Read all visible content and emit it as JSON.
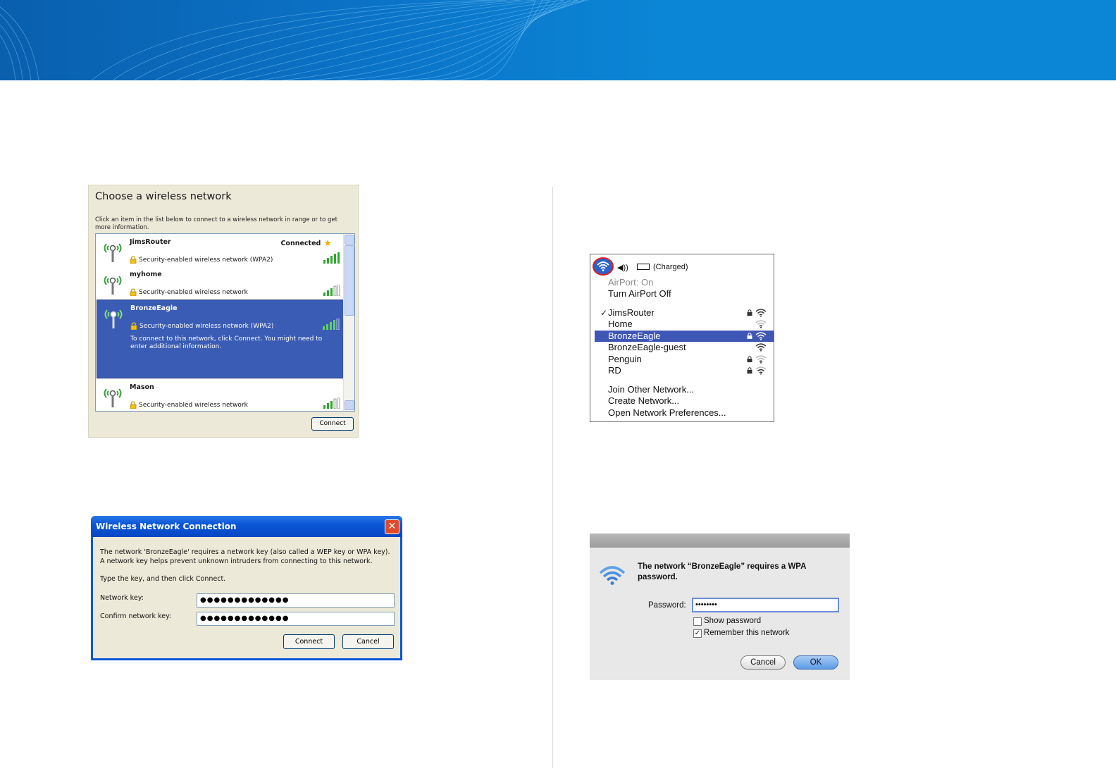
{
  "xp_choose": {
    "title": "Choose a wireless network",
    "instructions": "Click an item in the list below to connect to a wireless network in range or to get more information.",
    "networks": [
      {
        "name": "JimsRouter",
        "security": "Security-enabled wireless network (WPA2)",
        "status": "Connected",
        "signal_bars": 5
      },
      {
        "name": "myhome",
        "security": "Security-enabled wireless network",
        "status": "",
        "signal_bars": 3
      },
      {
        "name": "BronzeEagle",
        "security": "Security-enabled wireless network (WPA2)",
        "status": "",
        "signal_bars": 4,
        "hint": "To connect to this network, click Connect. You might need to enter additional information."
      },
      {
        "name": "Mason",
        "security": "Security-enabled wireless network",
        "status": "",
        "signal_bars": 3
      }
    ],
    "connect_label": "Connect"
  },
  "xp_dialog": {
    "title": "Wireless Network Connection",
    "message": "The network 'BronzeEagle' requires a network key (also called a WEP key or WPA key). A network key helps prevent unknown intruders from connecting to this network.",
    "message2": "Type the key, and then click Connect.",
    "network_key_label": "Network key:",
    "network_key_value": "●●●●●●●●●●●●●",
    "confirm_key_label": "Confirm network key:",
    "confirm_key_value": "●●●●●●●●●●●●●",
    "connect_label": "Connect",
    "cancel_label": "Cancel"
  },
  "mac_menu": {
    "charged": "(Charged)",
    "airport_status": "AirPort: On",
    "turn_off": "Turn AirPort Off",
    "networks": [
      {
        "name": "JimsRouter",
        "checked": true,
        "locked": true,
        "signal": "strong"
      },
      {
        "name": "Home",
        "checked": false,
        "locked": false,
        "signal": "weak"
      },
      {
        "name": "BronzeEagle",
        "checked": false,
        "locked": true,
        "signal": "strong",
        "selected": true
      },
      {
        "name": "BronzeEagle-guest",
        "checked": false,
        "locked": false,
        "signal": "strong"
      },
      {
        "name": "Penguin",
        "checked": false,
        "locked": true,
        "signal": "weak"
      },
      {
        "name": "RD",
        "checked": false,
        "locked": true,
        "signal": "weak"
      }
    ],
    "join_other": "Join Other Network...",
    "create": "Create Network...",
    "open_prefs": "Open Network Preferences..."
  },
  "mac_dialog": {
    "message": "The network “BronzeEagle” requires a WPA password.",
    "password_label": "Password:",
    "password_value": "••••••••",
    "show_password": "Show password",
    "show_password_checked": false,
    "remember": "Remember this network",
    "remember_checked": true,
    "cancel_label": "Cancel",
    "ok_label": "OK"
  },
  "colors": {
    "banner": "#0b86d6",
    "xp_selection": "#3a5cb5",
    "mac_selection": "#3f57b4",
    "highlight_circle": "#e02020"
  }
}
